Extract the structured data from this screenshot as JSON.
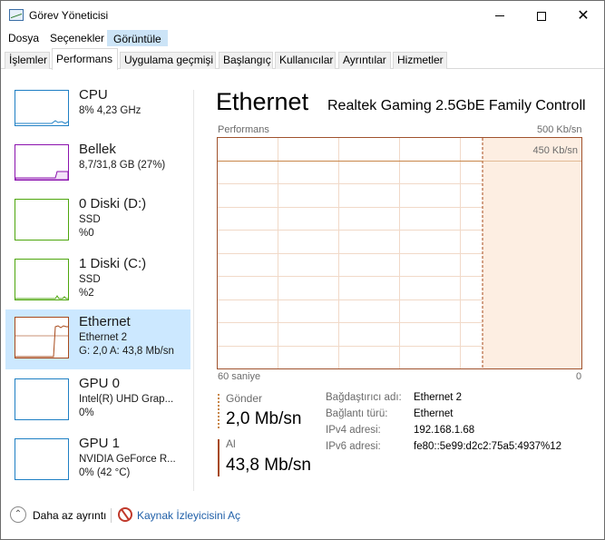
{
  "window": {
    "title": "Görev Yöneticisi",
    "controls": {
      "minimize": "minimize",
      "maximize": "maximize",
      "close": "✕"
    }
  },
  "menu": [
    "Dosya",
    "Seçenekler",
    "Görüntüle"
  ],
  "tabs": [
    "İşlemler",
    "Performans",
    "Uygulama geçmişi",
    "Başlangıç",
    "Kullanıcılar",
    "Ayrıntılar",
    "Hizmetler"
  ],
  "selected_tab": "Performans",
  "sidebar": {
    "items": [
      {
        "name": "CPU",
        "line1": "8% 4,23 GHz",
        "line2": "",
        "color": "#1e7fc4"
      },
      {
        "name": "Bellek",
        "line1": "8,7/31,8 GB (27%)",
        "line2": "",
        "color": "#8b12ae"
      },
      {
        "name": "0 Diski (D:)",
        "line1": "SSD",
        "line2": "%0",
        "color": "#4da60c"
      },
      {
        "name": "1 Diski (C:)",
        "line1": "SSD",
        "line2": "%2",
        "color": "#4da60c"
      },
      {
        "name": "Ethernet",
        "line1": "Ethernet 2",
        "line2": "G: 2,0 A: 43,8 Mb/sn",
        "color": "#a7491a"
      },
      {
        "name": "GPU 0",
        "line1": "Intel(R) UHD Grap...",
        "line2": "0%",
        "color": "#1e7fc4"
      },
      {
        "name": "GPU 1",
        "line1": "NVIDIA GeForce R...",
        "line2": "0% (42 °C)",
        "color": "#1e7fc4"
      }
    ]
  },
  "main": {
    "title": "Ethernet",
    "adapter": "Realtek Gaming 2.5GbE Family Controll...",
    "graph": {
      "label": "Performans",
      "max_label": "500 Kb/sn",
      "inner_label": "450 Kb/sn",
      "x_left_label": "60 saniye",
      "x_right_label": "0",
      "accent_color": "#a7491a",
      "fill_color": "#fdeee2"
    },
    "send": {
      "label": "Gönder",
      "value": "2,0 Mb/sn",
      "color": "#c8874a"
    },
    "receive": {
      "label": "Al",
      "value": "43,8 Mb/sn",
      "color": "#a7491a"
    },
    "details": [
      {
        "label": "Bağdaştırıcı adı:",
        "value": "Ethernet 2"
      },
      {
        "label": "Bağlantı türü:",
        "value": "Ethernet"
      },
      {
        "label": "IPv4 adresi:",
        "value": "192.168.1.68"
      },
      {
        "label": "IPv6 adresi:",
        "value": "fe80::5e99:d2c2:75a5:4937%12"
      }
    ]
  },
  "footer": {
    "less_details": "Daha az ayrıntı",
    "resource_monitor": "Kaynak İzleyicisini Aç"
  }
}
